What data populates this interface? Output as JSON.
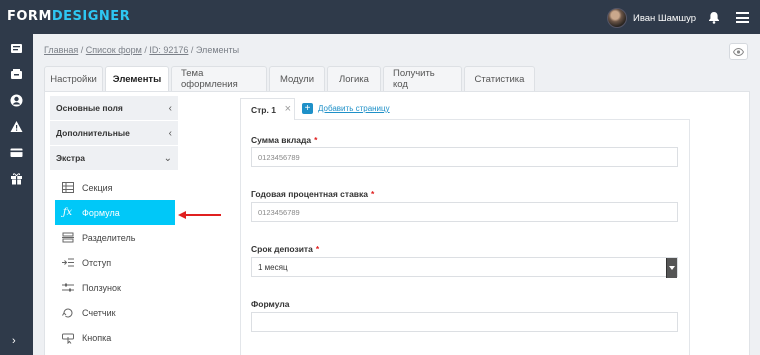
{
  "brand": {
    "part1": "FORM",
    "part2": "DESIGNER"
  },
  "user": {
    "name": "Иван Шамшур"
  },
  "breadcrumb": {
    "home": "Главная",
    "sep1": " / ",
    "forms": "Список форм",
    "sep2": " / ",
    "id": "ID: 92176",
    "current": " / Элементы"
  },
  "tabs": [
    {
      "label": "Настройки"
    },
    {
      "label": "Элементы"
    },
    {
      "label": "Тема оформления"
    },
    {
      "label": "Модули"
    },
    {
      "label": "Логика"
    },
    {
      "label": "Получить код"
    },
    {
      "label": "Статистика"
    }
  ],
  "accordion": [
    {
      "label": "Основные поля",
      "chevron": "‹"
    },
    {
      "label": "Дополнительные",
      "chevron": "‹"
    },
    {
      "label": "Экстра",
      "chevron": "⌄"
    }
  ],
  "extra_items": [
    {
      "label": "Секция",
      "icon": "section-icon"
    },
    {
      "label": "Формула",
      "icon": "formula-icon"
    },
    {
      "label": "Разделитель",
      "icon": "divider-icon"
    },
    {
      "label": "Отступ",
      "icon": "indent-icon"
    },
    {
      "label": "Ползунок",
      "icon": "slider-icon"
    },
    {
      "label": "Счетчик",
      "icon": "counter-icon"
    },
    {
      "label": "Кнопка",
      "icon": "button-icon"
    }
  ],
  "page_tab": {
    "label": "Стр. 1",
    "close": "×"
  },
  "add_page": {
    "plus": "+",
    "label": "Добавить страницу"
  },
  "fields": [
    {
      "label": "Сумма вклада",
      "required": "*",
      "placeholder": "0123456789"
    },
    {
      "label": "Годовая процентная ставка",
      "required": "*",
      "placeholder": "0123456789"
    },
    {
      "label": "Срок депозита",
      "required": "*",
      "value": "1 месяц"
    },
    {
      "label": "Формула",
      "value": ""
    }
  ],
  "colors": {
    "topbar": "#2f3a4a",
    "accent": "#00c8f8",
    "brand_accent": "#2ec7f2",
    "arrow": "#e02020"
  }
}
